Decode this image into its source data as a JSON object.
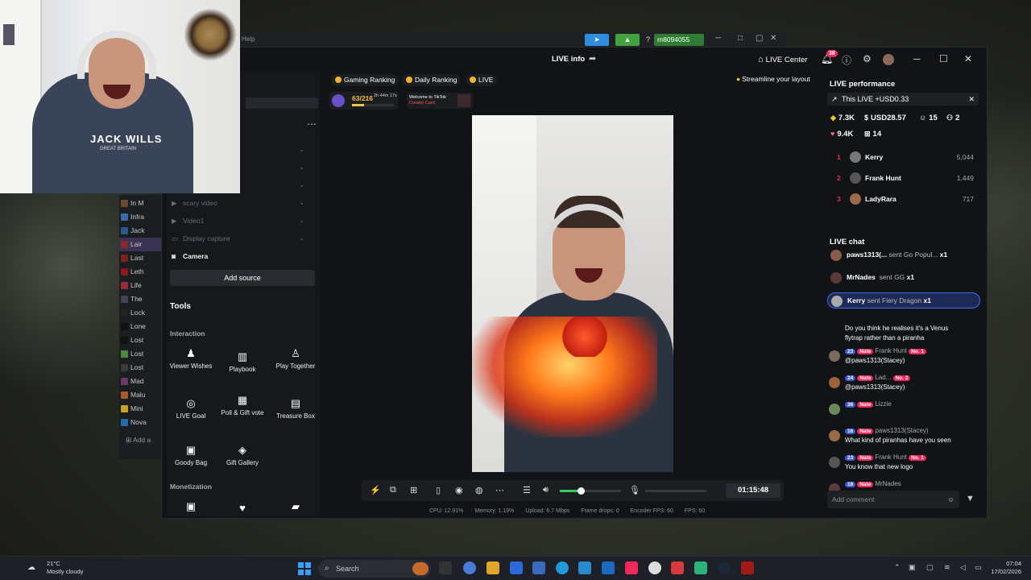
{
  "bg_app": {
    "menu_help": "Help",
    "account": "m8094055"
  },
  "game_list": {
    "items": [
      "In M",
      "Infra",
      "Jack",
      "Lair",
      "Last",
      "Leth",
      "Life",
      "The",
      "Lock",
      "Lone",
      "Lost",
      "Lost",
      "Lost",
      "Mad",
      "Malu",
      "Mini",
      "Nova"
    ],
    "selected": 3,
    "add_label": "Add a"
  },
  "window": {
    "title": "LIVE info",
    "live_center": "LIVE Center",
    "notif_count": "38"
  },
  "sources": {
    "items": [
      "scary video",
      "Video1",
      "Display capture",
      "Camera"
    ],
    "add_source": "Add source"
  },
  "tools": {
    "heading": "Tools",
    "interaction_heading": "Interaction",
    "interaction": [
      "Viewer Wishes",
      "Playbook",
      "Play Together",
      "LIVE Goal",
      "Poll & Gift vote",
      "Treasure Box",
      "Goody Bag",
      "Gift Gallery"
    ],
    "monetization_heading": "Monetization"
  },
  "rankings": {
    "gaming": "Gaming Ranking",
    "daily": "Daily Ranking",
    "live": "LIVE",
    "streamline": "Streamline your layout"
  },
  "progress": {
    "value": "63/216",
    "time": "2h 44m 17s",
    "fraction": 0.29
  },
  "card": {
    "line1": "Welcome to TikTok",
    "line2": "Creator Card"
  },
  "controls": {
    "timer": "01:15:48",
    "volume": 0.34
  },
  "stats": {
    "cpu": "CPU: 12.91%",
    "memory": "Memory: 1.19%",
    "upload": "Upload: 6.7 Mbps",
    "frame_drops": "Frame drops: 0",
    "encoder_fps": "Encoder FPS: 60",
    "fps": "FPS: 60"
  },
  "performance": {
    "heading": "LIVE performance",
    "this_live": "This LIVE +USD0.33",
    "diamonds": "7.3K",
    "usd": "USD28.57",
    "viewers": "15",
    "new_followers": "2",
    "likes": "9.4K",
    "gifters": "14",
    "top": [
      {
        "rank": "1",
        "name": "Kerry",
        "score": "5,044"
      },
      {
        "rank": "2",
        "name": "Frank Hunt",
        "score": "1,449"
      },
      {
        "rank": "3",
        "name": "LadyRara",
        "score": "717"
      }
    ]
  },
  "chat": {
    "heading": "LIVE chat",
    "gifts": [
      {
        "user": "paws1313(...",
        "text": "sent Go Popul...",
        "count": "x1"
      },
      {
        "user": "MrNades",
        "text": "sent GG",
        "count": "x1"
      },
      {
        "user": "Kerry",
        "text": "sent Fiery Dragon",
        "count": "x1"
      }
    ],
    "pinned": "Do you think he realises it's a Venus",
    "pinned2": "flytrap rather than a piranha",
    "messages": [
      {
        "lv": "23",
        "tag": "Nate",
        "user": "Frank Hunt",
        "no": "No. 1",
        "text": "@paws1313(Stacey)"
      },
      {
        "lv": "24",
        "tag": "Nate",
        "user": "Lad...",
        "no": "No. 2",
        "text": "@paws1313(Stacey)"
      },
      {
        "lv": "36",
        "tag": "Nate",
        "user": "Lizzie",
        "no": "",
        "text": ""
      },
      {
        "lv": "16",
        "tag": "Nate",
        "user": "paws1313(Stacey)",
        "no": "",
        "text": "What kind of piranhas have you seen"
      },
      {
        "lv": "23",
        "tag": "Nate",
        "user": "Frank Hunt",
        "no": "No. 1",
        "text": "You know that new logo"
      },
      {
        "lv": "19",
        "tag": "Nate",
        "user": "MrNades",
        "no": "",
        "text": "shark"
      }
    ],
    "placeholder": "Add comment"
  },
  "webcam": {
    "logo": "JACK WILLS",
    "logo_sub": "GREAT BRITAIN"
  },
  "taskbar": {
    "temp": "21°C",
    "weather": "Mostly cloudy",
    "search": "Search",
    "time": "07:04",
    "date": "17/02/2026"
  }
}
